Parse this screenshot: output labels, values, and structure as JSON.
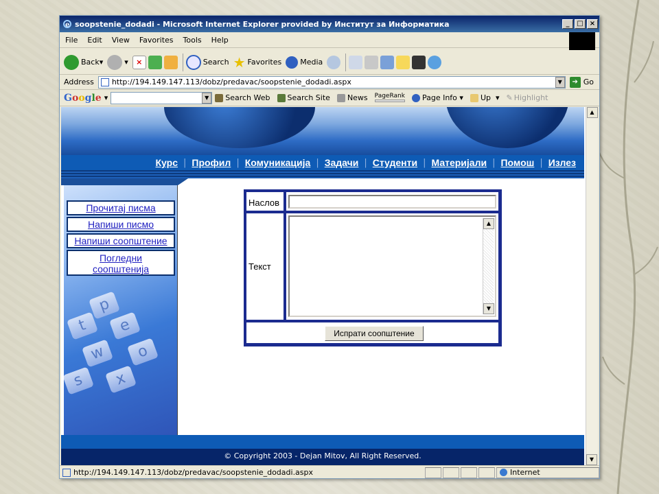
{
  "window": {
    "title": "soopstenie_dodadi - Microsoft Internet Explorer provided by Институт за Информатика",
    "controls": [
      "_",
      "□",
      "×"
    ]
  },
  "menu": [
    "File",
    "Edit",
    "View",
    "Favorites",
    "Tools",
    "Help"
  ],
  "toolbar": {
    "back": "Back",
    "search": "Search",
    "favorites": "Favorites",
    "media": "Media"
  },
  "address": {
    "label": "Address",
    "url": "http://194.149.147.113/dobz/predavac/soopstenie_dodadi.aspx",
    "go": "Go"
  },
  "google_bar": {
    "logo": "Google",
    "search_web": "Search Web",
    "search_site": "Search Site",
    "news": "News",
    "pagerank": "PageRank",
    "page_info": "Page Info",
    "up": "Up",
    "highlight": "Highlight"
  },
  "site_nav": [
    "Курс",
    "Профил",
    "Комуникација",
    "Задачи",
    "Студенти",
    "Материјали",
    "Помош",
    "Излез"
  ],
  "sidebar": [
    "Прочитај писма",
    "Напиши писмо",
    "Напиши соопштение",
    "Погледни соопштенија"
  ],
  "form": {
    "title_label": "Наслов",
    "title_value": "",
    "text_label": "Текст",
    "text_value": "",
    "submit": "Испрати соопштение"
  },
  "footer": {
    "copyright": "© Copyright 2003 - Dejan Mitov, All Right Reserved."
  },
  "status": {
    "url": "http://194.149.147.113/dobz/predavac/soopstenie_dodadi.aspx",
    "zone": "Internet"
  },
  "colors": {
    "nav_blue": "#0e5bb5",
    "footer_dark": "#062569",
    "form_border": "#1b2b8f",
    "link": "#2020c0"
  }
}
